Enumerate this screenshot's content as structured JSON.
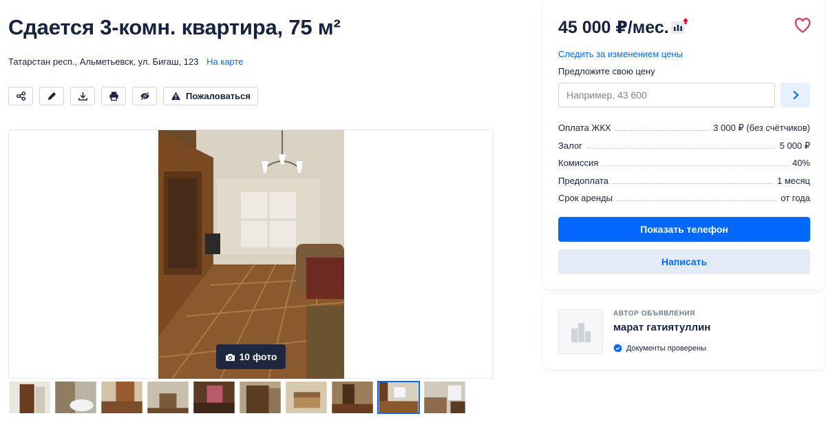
{
  "listing": {
    "title": "Сдается 3-комн. квартира, 75 м²",
    "address": "Татарстан респ., Альметьевск, ул. Бигаш, 123",
    "map_link": "На карте"
  },
  "toolbar": {
    "icons": [
      "share-icon",
      "edit-icon",
      "download-icon",
      "print-icon",
      "hide-icon"
    ],
    "report_label": "Пожаловаться"
  },
  "gallery": {
    "photo_count_label": "10 фото",
    "thumbnail_count": 10,
    "active_thumbnail": 9
  },
  "pricing": {
    "price": "45 000 ₽/мес.",
    "watch_price_link": "Следить за изменением цены",
    "offer_label": "Предложите свою цену",
    "offer_placeholder": "Например, 43 600",
    "terms": [
      {
        "label": "Оплата ЖКХ",
        "value": "3 000 ₽ (без счётчиков)"
      },
      {
        "label": "Залог",
        "value": "5 000 ₽"
      },
      {
        "label": "Комиссия",
        "value": "40%"
      },
      {
        "label": "Предоплата",
        "value": "1 месяц"
      },
      {
        "label": "Срок аренды",
        "value": "от года"
      }
    ],
    "show_phone_label": "Показать телефон",
    "write_label": "Написать"
  },
  "author": {
    "caption": "Автор объявления",
    "name": "марат гатиятуллин",
    "verified_label": "Документы проверены"
  },
  "colors": {
    "accent": "#0468ff",
    "text": "#152242",
    "favorite": "#e2345a",
    "price_up": "#e8001c"
  }
}
